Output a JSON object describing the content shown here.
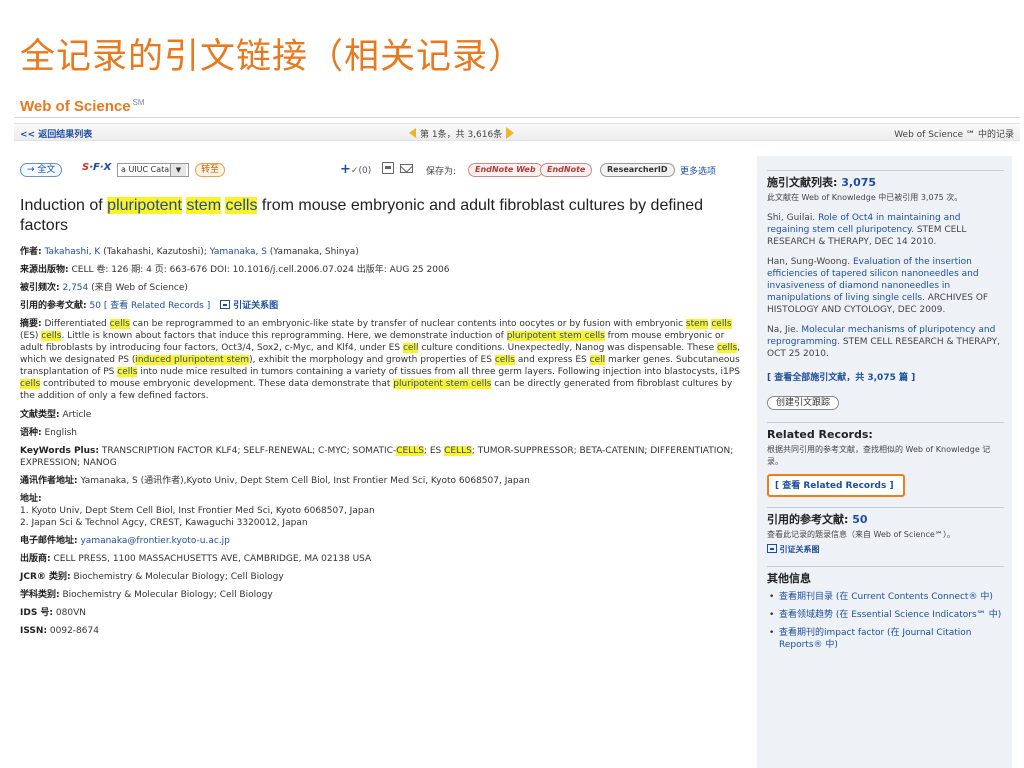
{
  "slide_title": "全记录的引文链接（相关记录）",
  "brand": {
    "name": "Web of Science",
    "mark": "SM"
  },
  "nav": {
    "back": "<< 返回结果列表",
    "pager": "第 1条，共 3,616条",
    "right": "Web of Science ℠ 中的记录"
  },
  "toolbar": {
    "full_text": "→ 全文",
    "sfx_s": "S",
    "sfx_rest": "·F·X",
    "catalog": "a UIUC Catalog",
    "go": "转至",
    "add_count": "(0)",
    "save_as": "保存为:",
    "endnote_web": "EndNote Web",
    "endnote": "EndNote",
    "researcherid": "ResearcherID",
    "more": "更多选项"
  },
  "article": {
    "title_pre": "Induction of ",
    "title_hl1": "pluripotent",
    "title_hl2": "stem",
    "title_hl3": "cells",
    "title_post": " from mouse embryonic and adult fibroblast cultures by defined factors",
    "author_label": "作者:",
    "author_1": "Takahashi, K",
    "author_1_full": " (Takahashi, Kazutoshi); ",
    "author_2": "Yamanaka, S",
    "author_2_full": " (Yamanaka, Shinya)",
    "source_label": "来源出版物:",
    "source": " CELL  卷: 126  期: 4  页: 663-676  DOI: 10.1016/j.cell.2006.07.024  出版年: AUG 25 2006",
    "times_cited_label": "被引频次:",
    "times_cited": "2,754",
    "times_cited_src": " (来自 Web of Science)",
    "refs_label": "引用的参考文献:",
    "refs_count": "50",
    "refs_view": "[ 查看  Related Records ]",
    "citation_map": "引证关系图",
    "abstract_label": "摘要:",
    "abstract_1": " Differentiated ",
    "abstract_2": " can be reprogrammed to an embryonic-like state by transfer of nuclear contents into oocytes or by fusion with embryonic ",
    "abstract_3": " (ES) ",
    "abstract_4": ". Little is known about factors that induce this reprogramming. Here, we demonstrate induction of ",
    "abstract_5": " from mouse embryonic or adult fibroblasts by introducing four factors, Oct3/4, Sox2, c-Myc, and Klf4, under ES ",
    "abstract_6": " culture conditions. Unexpectedly, Nanog was dispensable. These ",
    "abstract_7": ", which we designated PS (",
    "abstract_8": "), exhibit the morphology and growth properties of ES ",
    "abstract_9": " and express ES ",
    "abstract_10": " marker genes. Subcutaneous transplantation of PS ",
    "abstract_11": " into nude mice resulted in tumors containing a variety of tissues from all three germ layers. Following injection into blastocysts, i1PS ",
    "abstract_12": " contributed to mouse embryonic development. These data demonstrate that ",
    "abstract_13": " can be directly generated from fibroblast cultures by the addition of only a few defined factors.",
    "hl_cells": "cells",
    "hl_stem": "stem",
    "hl_cell": "cell",
    "hl_psc": "pluripotent stem cells",
    "hl_ips": "induced pluripotent stem",
    "doctype_label": "文献类型:",
    "doctype": " Article",
    "lang_label": "语种:",
    "lang": " English",
    "kw_label": "KeyWords Plus:",
    "kw_1": " TRANSCRIPTION FACTOR KLF4; SELF-RENEWAL; C-MYC; SOMATIC-",
    "kw_hl1": "CELLS",
    "kw_2": "; ES ",
    "kw_hl2": "CELLS",
    "kw_3": "; TUMOR-SUPPRESSOR; BETA-CATENIN; DIFFERENTIATION; EXPRESSION; NANOG",
    "corr_label": "通讯作者地址:",
    "corr": " Yamanaka, S (通讯作者),Kyoto Univ, Dept Stem Cell Biol, Inst Frontier Med Sci, Kyoto 6068507, Japan",
    "addr_label": "地址:",
    "addr_1": "1. Kyoto Univ, Dept Stem Cell Biol, Inst Frontier Med Sci, Kyoto 6068507, Japan",
    "addr_2": "2. Japan Sci & Technol Agcy, CREST, Kawaguchi 3320012, Japan",
    "email_label": "电子邮件地址:",
    "email": "yamanaka@frontier.kyoto-u.ac.jp",
    "publisher_label": "出版商:",
    "publisher": " CELL PRESS, 1100 MASSACHUSETTS AVE, CAMBRIDGE, MA 02138 USA",
    "jcr_label": "JCR® 类别:",
    "jcr": " Biochemistry & Molecular Biology; Cell Biology",
    "subject_label": "学科类别:",
    "subject": " Biochemistry & Molecular Biology; Cell Biology",
    "ids_label": "IDS 号:",
    "ids": " 080VN",
    "issn_label": "ISSN:",
    "issn": " 0092-8674"
  },
  "sidebar": {
    "citing_label": "施引文献列表: ",
    "citing_count": "3,075",
    "citing_sub": "此文献在  Web of Knowledge 中已被引用  3,075 次。",
    "ref1_author": "Shi, Guilai. ",
    "ref1_title": "Role of Oct4 in maintaining and regaining stem cell pluripotency.",
    "ref1_src": " STEM CELL RESEARCH & THERAPY, DEC 14 2010.",
    "ref2_author": "Han, Sung-Woong. ",
    "ref2_title": "Evaluation of the insertion efficiencies of tapered silicon nanoneedles and invasiveness of diamond nanoneedles in manipulations of living single cells.",
    "ref2_src": " ARCHIVES OF HISTOLOGY AND CYTOLOGY, DEC 2009.",
    "ref3_author": "Na, Jie. ",
    "ref3_title": "Molecular mechanisms of pluripotency and reprogramming.",
    "ref3_src": " STEM CELL RESEARCH & THERAPY, OCT 25 2010.",
    "view_all": "[ 查看全部施引文献，共  3,075 篇  ]",
    "track": "创建引文跟踪",
    "related_h": "Related Records:",
    "related_sub": "根据共同引用的参考文献，查找相似的  Web of Knowledge 记录。",
    "related_btn": "[ 查看   Related Records ]",
    "cited_refs_label": "引用的参考文献: ",
    "cited_refs_count": "50",
    "cited_refs_sub": "查看此记录的题录信息（来自  Web of Science℠）。",
    "citation_map": "引证关系图",
    "other_h": "其他信息",
    "other_1": "查看期刊目录 (在  Current Contents Connect® 中)",
    "other_2": "查看领域趋势 (在  Essential Science Indicators℠ 中)",
    "other_3": "查看期刊的impact factor (在  Journal Citation Reports® 中)"
  }
}
